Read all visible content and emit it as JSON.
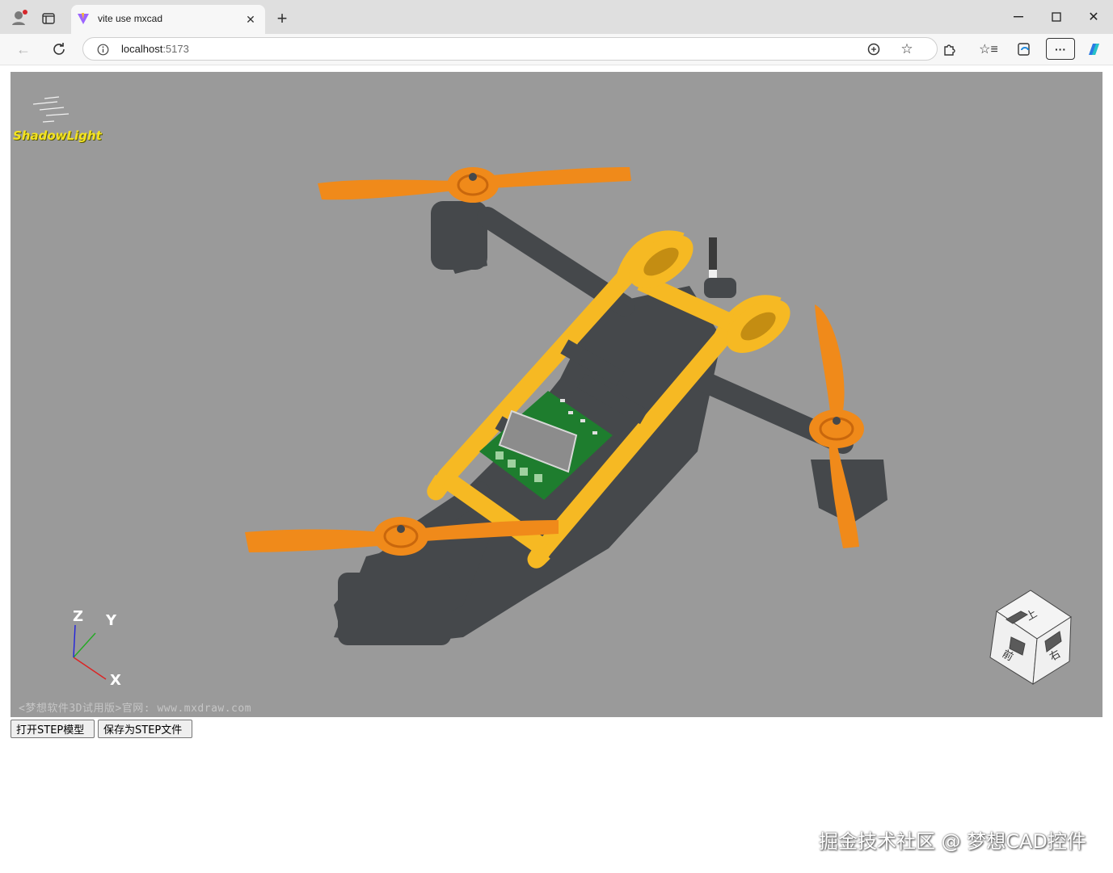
{
  "browser": {
    "tab_title": "vite use mxcad",
    "url_host": "localhost",
    "url_port": ":5173"
  },
  "viewer": {
    "brand": "ShadowLight",
    "watermark": "<梦想软件3D试用版>官网: www.mxdraw.com",
    "axes": {
      "x": "X",
      "y": "Y",
      "z": "Z"
    },
    "view_cube": {
      "top": "上",
      "front": "前",
      "right": "右"
    }
  },
  "actions": {
    "open_step": "打开STEP模型",
    "save_step": "保存为STEP文件"
  },
  "corner_watermark": "掘金技术社区 @ 梦想CAD控件",
  "colors": {
    "viewport": "#9a9a9a",
    "frame_yellow": "#f6b923",
    "propeller_orange": "#f08a1a",
    "body_dark": "#45484b",
    "pcb_green": "#1e7d2e"
  }
}
